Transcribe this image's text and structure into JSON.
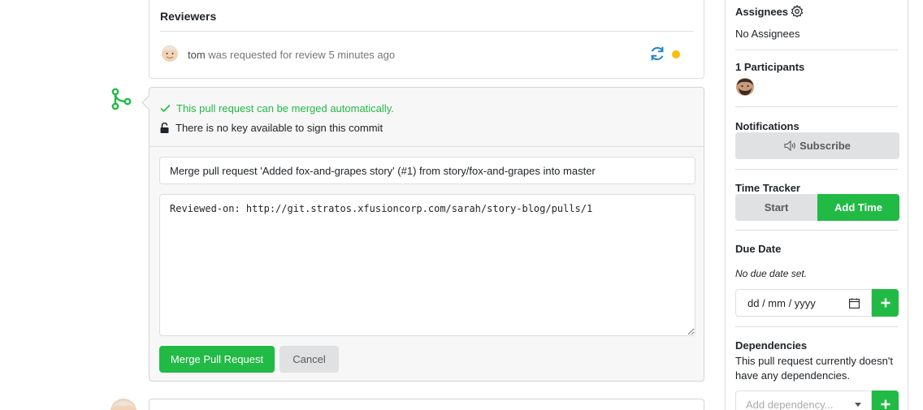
{
  "reviewers": {
    "title": "Reviewers",
    "entry": {
      "name": "tom",
      "action": "was requested for review",
      "time": "5 minutes ago"
    }
  },
  "merge": {
    "status_ok": "This pull request can be merged automatically.",
    "status_key": "There is no key available to sign this commit",
    "title_value": "Merge pull request 'Added fox-and-grapes story' (#1) from story/fox-and-grapes into master",
    "message_value": "Reviewed-on: http://git.stratos.xfusioncorp.com/sarah/story-blog/pulls/1",
    "merge_button": "Merge Pull Request",
    "cancel_button": "Cancel"
  },
  "sidebar": {
    "assignees_title": "Assignees",
    "assignees_value": "No Assignees",
    "participants_title": "1 Participants",
    "notifications_title": "Notifications",
    "subscribe_button": "Subscribe",
    "time_tracker_title": "Time Tracker",
    "start_button": "Start",
    "add_time_button": "Add Time",
    "due_date_title": "Due Date",
    "due_date_value": "No due date set.",
    "date_placeholder": "dd / mm / yyyy",
    "dependencies_title": "Dependencies",
    "dependencies_text": "This pull request currently doesn't have any dependencies.",
    "dependency_placeholder": "Add dependency..."
  },
  "colors": {
    "green": "#21ba45",
    "pending": "#fbbd08",
    "refresh": "#2185d0",
    "grey_button": "#e0e1e2"
  },
  "icons": [
    "gear-icon",
    "refresh-icon",
    "git-merge-icon",
    "check-icon",
    "unlock-icon",
    "speaker-icon",
    "calendar-icon",
    "plus-icon",
    "dropdown-caret-icon"
  ]
}
